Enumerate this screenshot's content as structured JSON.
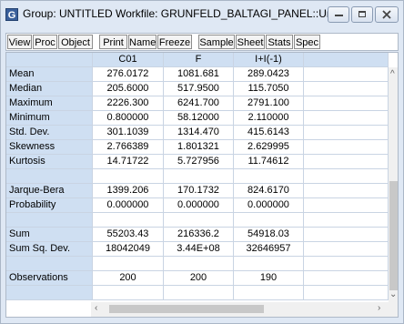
{
  "window": {
    "title": "Group: UNTITLED   Workfile: GRUNFELD_BALTAGI_PANEL::Unti...",
    "app_icon": "G"
  },
  "toolbar": {
    "buttons": [
      "View",
      "Proc",
      "Object",
      "Print",
      "Name",
      "Freeze",
      "Sample",
      "Sheet",
      "Stats",
      "Spec"
    ]
  },
  "table": {
    "columns": [
      "",
      "C01",
      "F",
      "I+I(-1)"
    ],
    "rows": [
      [
        "Mean",
        "276.0172",
        "1081.681",
        "289.0423"
      ],
      [
        "Median",
        "205.6000",
        "517.9500",
        "115.7050"
      ],
      [
        "Maximum",
        "2226.300",
        "6241.700",
        "2791.100"
      ],
      [
        "Minimum",
        "0.800000",
        "58.12000",
        "2.110000"
      ],
      [
        "Std. Dev.",
        "301.1039",
        "1314.470",
        "415.6143"
      ],
      [
        "Skewness",
        "2.766389",
        "1.801321",
        "2.629995"
      ],
      [
        "Kurtosis",
        "14.71722",
        "5.727956",
        "11.74612"
      ],
      [
        "",
        "",
        "",
        ""
      ],
      [
        "Jarque-Bera",
        "1399.206",
        "170.1732",
        "824.6170"
      ],
      [
        "Probability",
        "0.000000",
        "0.000000",
        "0.000000"
      ],
      [
        "",
        "",
        "",
        ""
      ],
      [
        "Sum",
        "55203.43",
        "216336.2",
        "54918.03"
      ],
      [
        "Sum Sq. Dev.",
        "18042049",
        "3.44E+08",
        "32646957"
      ],
      [
        "",
        "",
        "",
        ""
      ],
      [
        "Observations",
        "200",
        "200",
        "190"
      ],
      [
        "",
        "",
        "",
        ""
      ]
    ]
  },
  "icons": {
    "minimize": "minimize-icon",
    "maximize": "maximize-icon",
    "close": "close-icon"
  }
}
